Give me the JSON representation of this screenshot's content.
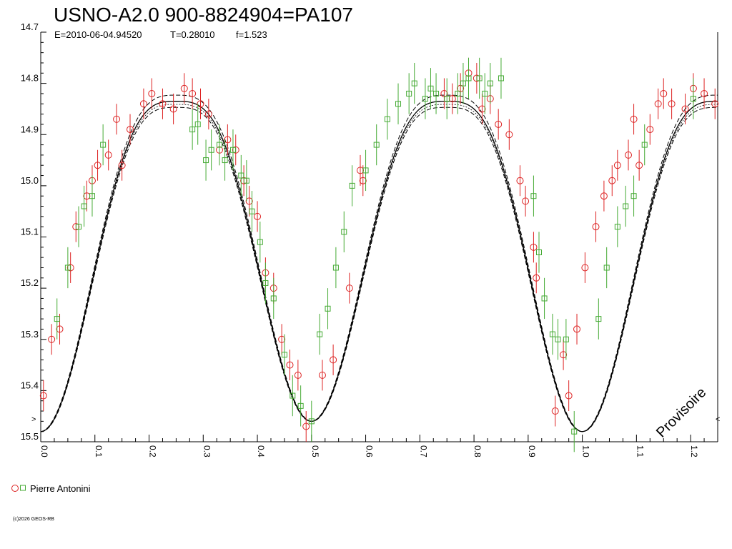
{
  "chart_data": {
    "type": "scatter",
    "title": "USNO-A2.0 900-8824904=PA107",
    "subtitle": {
      "epoch": "E=2010-06-04.94520",
      "period": "T=0.28010",
      "f": "f=1.523"
    },
    "xlabel": "",
    "ylabel": "",
    "xlim": [
      0.0,
      1.25
    ],
    "ylim": [
      14.7,
      15.5
    ],
    "y_inverted": true,
    "y_ticks": [
      "14.7",
      "14.8",
      "14.9",
      "15.0",
      "15.1",
      "15.2",
      "15.3",
      "15.4",
      "15.5"
    ],
    "x_ticks": [
      "0.0",
      "0.1",
      "0.2",
      "0.3",
      "0.4",
      "0.5",
      "0.6",
      "0.7",
      "0.8",
      "0.9",
      "1.0",
      "1.1",
      "1.2"
    ],
    "grid": false,
    "legend_position": "bottom-left",
    "legend_label": "Pierre Antonini",
    "edge_markers": [
      ">",
      "<"
    ],
    "watermark": "Provisoire",
    "credit": "(c)2026 GEOS-RB",
    "colors": {
      "red_series": "#dd2222",
      "green_series": "#44aa33",
      "model": "#000000"
    },
    "model_curve": {
      "description_params": {
        "max_mag": 14.835,
        "primary_min": 15.48,
        "secondary_min": 15.46
      }
    },
    "series": [
      {
        "marker": "circle",
        "color": "#dd2222",
        "x": [
          0.005,
          0.02,
          0.035,
          0.055,
          0.065,
          0.085,
          0.095,
          0.105,
          0.125,
          0.14,
          0.15,
          0.165,
          0.19,
          0.205,
          0.225,
          0.245,
          0.265,
          0.28,
          0.295,
          0.31,
          0.33,
          0.345,
          0.36,
          0.375,
          0.385,
          0.4,
          0.415,
          0.43,
          0.445,
          0.46,
          0.475,
          0.49,
          0.52,
          0.54,
          0.57,
          0.59,
          0.595,
          0.745,
          0.76,
          0.775,
          0.79,
          0.805,
          0.815,
          0.83,
          0.845,
          0.865,
          0.885,
          0.895,
          0.91,
          0.915,
          0.95,
          0.965,
          0.975,
          0.99,
          1.005,
          1.025,
          1.04,
          1.055,
          1.065,
          1.085,
          1.095,
          1.105,
          1.125,
          1.14,
          1.15,
          1.165,
          1.19,
          1.205,
          1.225,
          1.245
        ],
        "y": [
          15.41,
          15.3,
          15.28,
          15.16,
          15.08,
          15.02,
          14.99,
          14.96,
          14.94,
          14.87,
          14.96,
          14.89,
          14.84,
          14.82,
          14.84,
          14.85,
          14.81,
          14.82,
          14.84,
          14.86,
          14.93,
          14.91,
          14.93,
          14.99,
          15.03,
          15.06,
          15.17,
          15.2,
          15.3,
          15.35,
          15.37,
          15.47,
          15.37,
          15.34,
          15.2,
          14.97,
          14.99,
          14.82,
          14.83,
          14.81,
          14.78,
          14.79,
          14.85,
          14.83,
          14.88,
          14.9,
          14.99,
          15.03,
          15.12,
          15.18,
          15.44,
          15.33,
          15.41,
          15.28,
          15.16,
          15.08,
          15.02,
          14.99,
          14.96,
          14.94,
          14.87,
          14.96,
          14.89,
          14.84,
          14.82,
          14.84,
          14.85,
          14.81,
          14.82,
          14.84
        ],
        "err": [
          0.03,
          0.03,
          0.03,
          0.03,
          0.03,
          0.03,
          0.03,
          0.03,
          0.03,
          0.03,
          0.03,
          0.03,
          0.03,
          0.03,
          0.03,
          0.03,
          0.03,
          0.03,
          0.03,
          0.03,
          0.03,
          0.03,
          0.03,
          0.03,
          0.03,
          0.03,
          0.03,
          0.03,
          0.03,
          0.03,
          0.03,
          0.03,
          0.03,
          0.03,
          0.03,
          0.03,
          0.03,
          0.03,
          0.03,
          0.03,
          0.03,
          0.03,
          0.03,
          0.03,
          0.03,
          0.03,
          0.03,
          0.03,
          0.03,
          0.03,
          0.03,
          0.03,
          0.03,
          0.03,
          0.03,
          0.03,
          0.03,
          0.03,
          0.03,
          0.03,
          0.03,
          0.03,
          0.03,
          0.03,
          0.03,
          0.03,
          0.03,
          0.03,
          0.03,
          0.03
        ]
      },
      {
        "marker": "square",
        "color": "#44aa33",
        "x": [
          0.03,
          0.05,
          0.07,
          0.08,
          0.095,
          0.115,
          0.28,
          0.29,
          0.305,
          0.315,
          0.33,
          0.34,
          0.355,
          0.37,
          0.38,
          0.39,
          0.405,
          0.415,
          0.43,
          0.45,
          0.465,
          0.48,
          0.5,
          0.515,
          0.53,
          0.545,
          0.56,
          0.575,
          0.6,
          0.62,
          0.64,
          0.66,
          0.68,
          0.69,
          0.71,
          0.72,
          0.73,
          0.75,
          0.77,
          0.78,
          0.79,
          0.81,
          0.82,
          0.83,
          0.85,
          0.91,
          0.92,
          0.93,
          0.945,
          0.955,
          0.97,
          0.985,
          1.03,
          1.045,
          1.065,
          1.08,
          1.095,
          1.115,
          1.205
        ],
        "y": [
          15.26,
          15.16,
          15.08,
          15.04,
          15.02,
          14.92,
          14.89,
          14.88,
          14.95,
          14.93,
          14.92,
          14.95,
          14.93,
          14.98,
          14.99,
          15.05,
          15.11,
          15.19,
          15.22,
          15.33,
          15.41,
          15.43,
          15.46,
          15.29,
          15.24,
          15.16,
          15.09,
          15.0,
          14.97,
          14.92,
          14.87,
          14.84,
          14.82,
          14.8,
          14.83,
          14.81,
          14.82,
          14.83,
          14.82,
          14.8,
          14.79,
          14.79,
          14.82,
          14.8,
          14.79,
          15.02,
          15.13,
          15.22,
          15.29,
          15.3,
          15.3,
          15.48,
          15.26,
          15.16,
          15.08,
          15.04,
          15.02,
          14.92,
          14.83
        ],
        "err": [
          0.04,
          0.04,
          0.04,
          0.04,
          0.04,
          0.04,
          0.04,
          0.04,
          0.04,
          0.04,
          0.04,
          0.04,
          0.04,
          0.04,
          0.04,
          0.04,
          0.04,
          0.04,
          0.04,
          0.04,
          0.04,
          0.04,
          0.04,
          0.04,
          0.04,
          0.04,
          0.04,
          0.04,
          0.04,
          0.04,
          0.04,
          0.04,
          0.04,
          0.04,
          0.04,
          0.04,
          0.04,
          0.04,
          0.04,
          0.04,
          0.04,
          0.04,
          0.04,
          0.04,
          0.04,
          0.04,
          0.04,
          0.04,
          0.04,
          0.04,
          0.04,
          0.04,
          0.04,
          0.04,
          0.04,
          0.04,
          0.04,
          0.04,
          0.04
        ]
      }
    ]
  }
}
